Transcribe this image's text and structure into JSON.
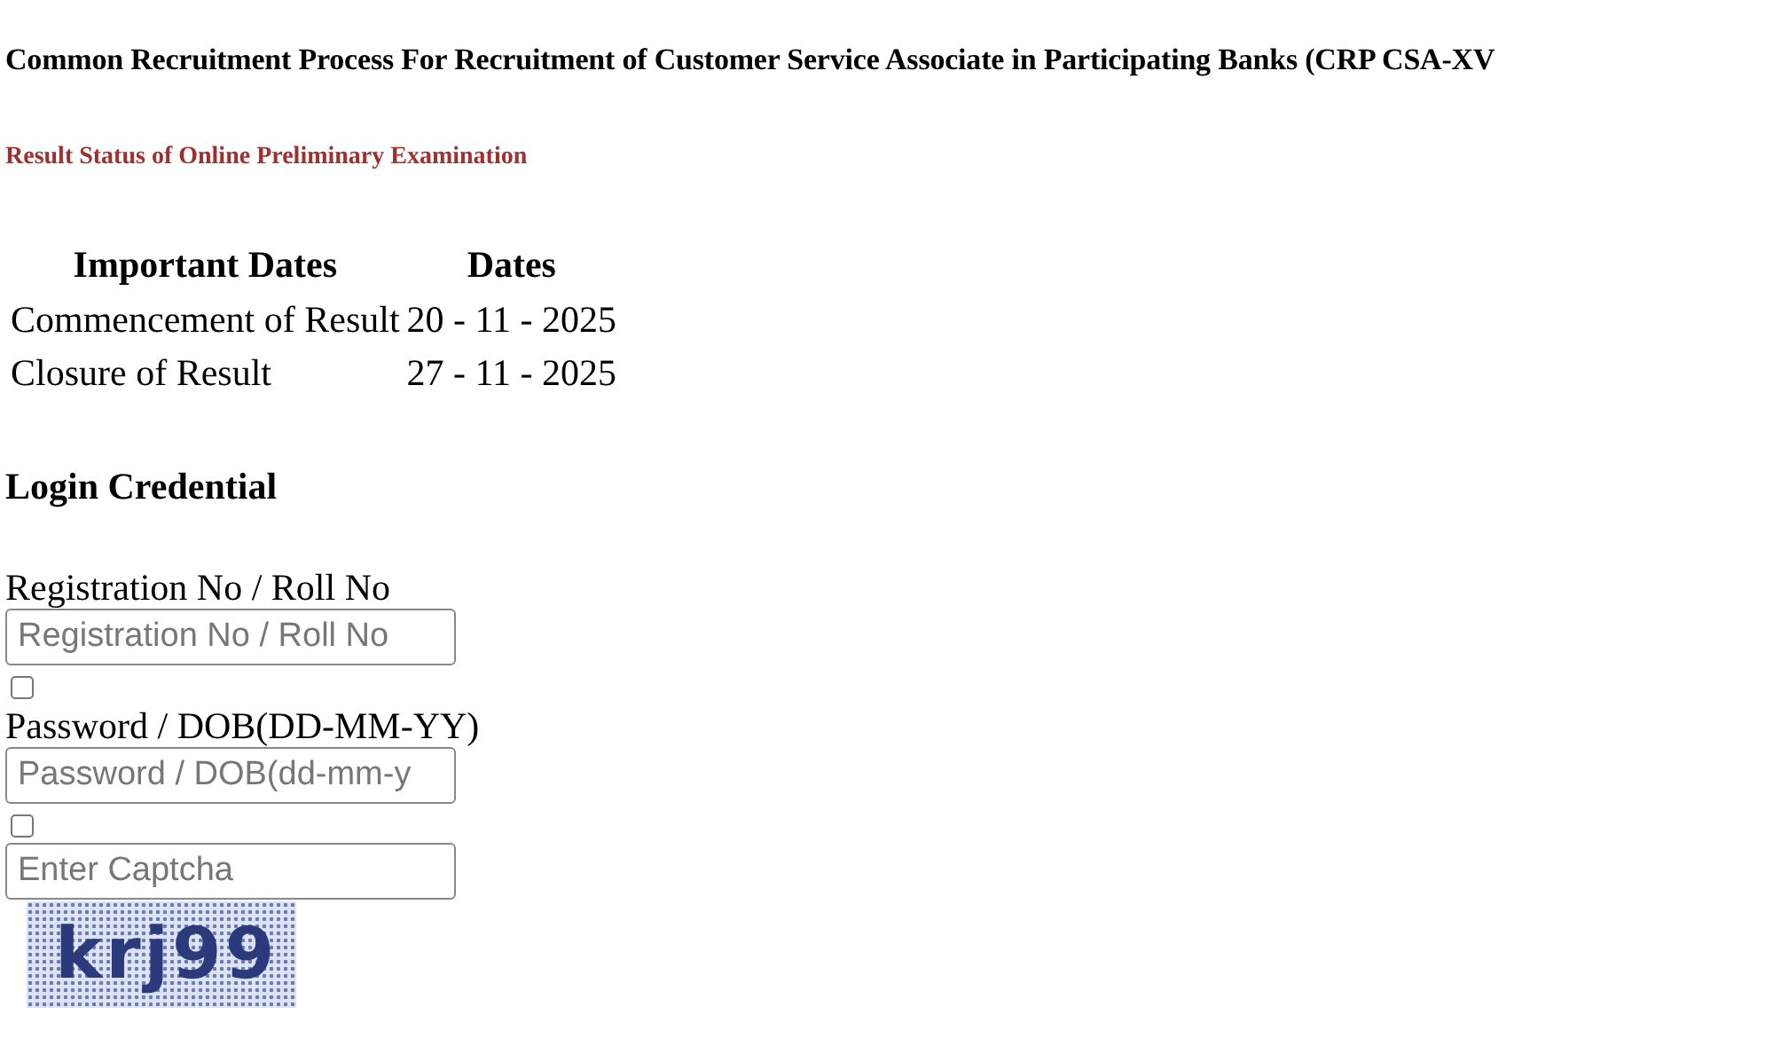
{
  "title": "Common Recruitment Process For Recruitment of Customer Service Associate in Participating Banks (CRP CSA-XV",
  "subtitle": "Result Status of Online Preliminary Examination",
  "dates_table": {
    "columns": [
      "Important Dates",
      "Dates"
    ],
    "rows": [
      [
        "Commencement of Result",
        "20 - 11 - 2025"
      ],
      [
        "Closure of Result",
        "27 - 11 - 2025"
      ]
    ]
  },
  "login": {
    "heading": "Login Credential",
    "fields": [
      {
        "kind": "input",
        "label": "Registration No / Roll No",
        "placeholder": "Registration No / Roll No"
      },
      {
        "kind": "checkbox",
        "checked": false
      },
      {
        "kind": "input",
        "label": "Password / DOB(DD-MM-YY)",
        "placeholder": "Password / DOB(dd-mm-y"
      },
      {
        "kind": "checkbox",
        "checked": false
      },
      {
        "kind": "input",
        "placeholder": "Enter Captcha"
      },
      {
        "kind": "captcha",
        "text": "krj99"
      }
    ]
  }
}
